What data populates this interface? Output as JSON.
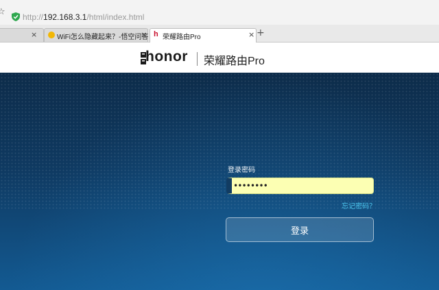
{
  "browser": {
    "url_scheme": "http://",
    "url_host": "192.168.3.1",
    "url_path": "/html/index.html",
    "tabs": [
      {
        "title": "WiFi怎么隐藏起来？-悟空问答",
        "close": "×"
      },
      {
        "title": "荣耀路由Pro",
        "close": "×"
      }
    ],
    "new_tab": "+",
    "active_favicon": "h"
  },
  "header": {
    "brand": "honor",
    "product": "荣耀路由Pro"
  },
  "login": {
    "label": "登录密码",
    "password_value": "••••••••",
    "forgot": "忘记密码？",
    "button": "登录"
  },
  "colors": {
    "bg_top": "#0d2c4a",
    "bg_bottom": "#135a92",
    "input_fill": "#fcffb3",
    "link": "#4ec8f0"
  }
}
